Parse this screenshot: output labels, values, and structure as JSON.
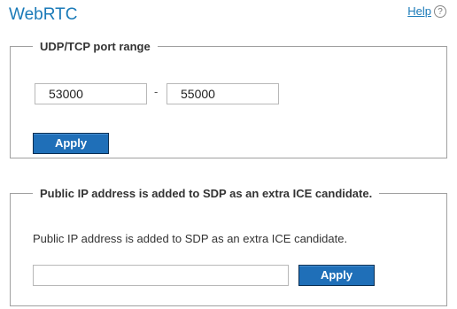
{
  "page": {
    "title": "WebRTC"
  },
  "help": {
    "label": "Help",
    "icon": "question-circle-icon",
    "icon_glyph": "?"
  },
  "port_range": {
    "legend": "UDP/TCP port range",
    "start_value": "53000",
    "separator": "-",
    "end_value": "55000",
    "apply_label": "Apply"
  },
  "public_ip": {
    "legend": "Public IP address is added to SDP as an extra ICE candidate.",
    "description": "Public IP address is added to SDP as an extra ICE candidate.",
    "value": "",
    "apply_label": "Apply"
  },
  "colors": {
    "accent": "#1a7ab8",
    "button": "#1f6fb8"
  }
}
